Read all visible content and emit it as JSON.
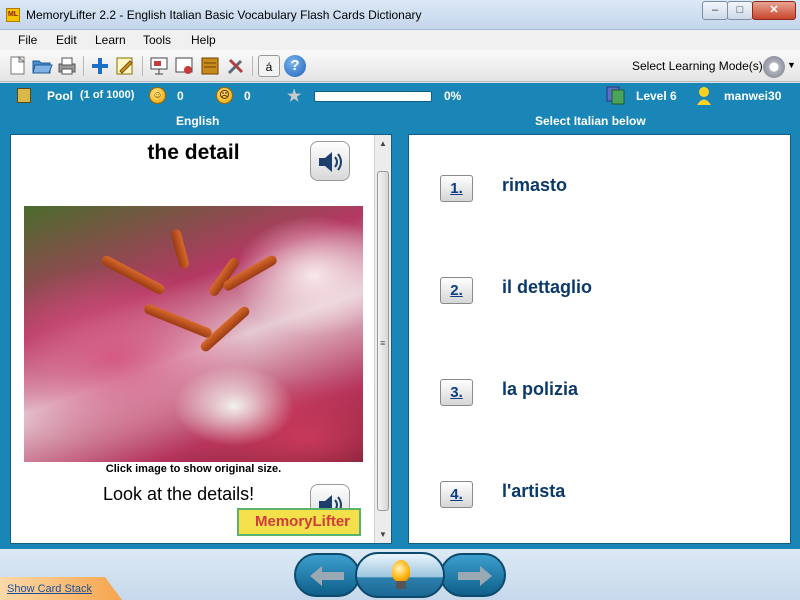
{
  "window": {
    "app_icon_text": "ML",
    "title": "MemoryLifter 2.2 - English Italian Basic Vocabulary Flash Cards Dictionary",
    "minimize": "–",
    "maximize": "□",
    "close": "✕"
  },
  "menu": [
    "File",
    "Edit",
    "Learn",
    "Tools",
    "Help"
  ],
  "toolbar": {
    "icons": [
      "new-document-icon",
      "open-folder-icon",
      "print-icon",
      "add-card-icon",
      "edit-card-icon",
      "presentation-icon",
      "card-slide-icon",
      "box-icon",
      "settings-tools-icon",
      "dictionary-a-icon",
      "help-icon"
    ],
    "learning_mode_label": "Select Learning Mode(s)",
    "help_glyph": "?",
    "dict_glyph": "á"
  },
  "status": {
    "pool_label": "Pool",
    "pool_count": "(1 of 1000)",
    "happy_count": "0",
    "sad_count": "0",
    "progress_percent": "0%",
    "progress_value": 0,
    "level": "Level 6",
    "user": "manwei30"
  },
  "left_pane": {
    "title": "English",
    "question": "the detail",
    "caption": "Click image to show original size.",
    "example": "Look at the details!",
    "logo_text": "MemoryLifter"
  },
  "right_pane": {
    "title": "Select Italian below",
    "answers": [
      {
        "num": "1.",
        "text": "rimasto"
      },
      {
        "num": "2.",
        "text": "il dettaglio"
      },
      {
        "num": "3.",
        "text": "la polizia"
      },
      {
        "num": "4.",
        "text": "l'artista"
      }
    ]
  },
  "footer": {
    "card_stack_link": "Show Card Stack"
  },
  "colors": {
    "accent_blue": "#1a86b8",
    "answer_text": "#0b3a6a"
  }
}
